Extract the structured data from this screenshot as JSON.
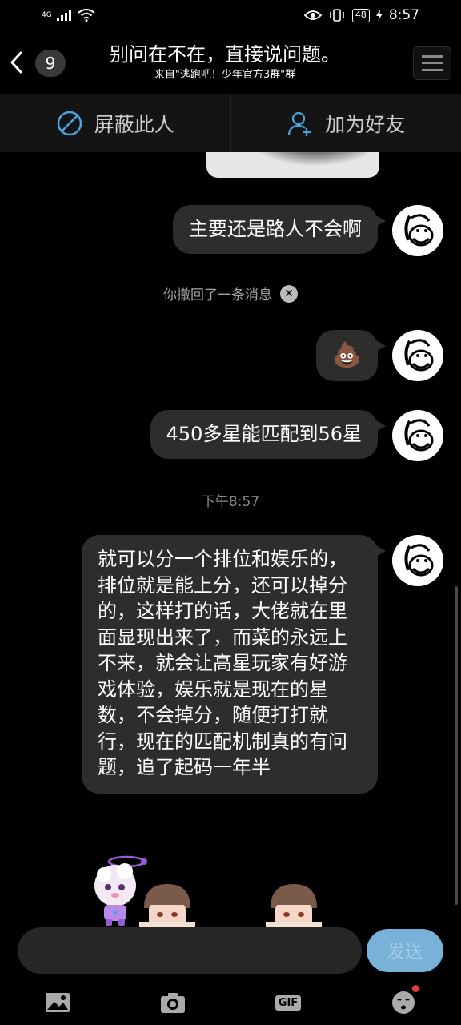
{
  "status_bar": {
    "network": "4G",
    "battery": "48",
    "time": "8:57"
  },
  "header": {
    "unread_count": "9",
    "title": "别问在不在，直接说问题。",
    "subtitle": "来自\"逃跑吧！少年官方3群\"群"
  },
  "actions": {
    "block_label": "屏蔽此人",
    "add_friend_label": "加为好友"
  },
  "messages": [
    {
      "text": "主要还是路人不会啊"
    },
    {
      "text": "💩"
    },
    {
      "text": "450多星能匹配到56星"
    },
    {
      "text": "就可以分一个排位和娱乐的，排位就是能上分，还可以掉分的，这样打的话，大佬就在里面显现出来了，而菜的永远上不来，就会让高星玩家有好游戏体验，娱乐就是现在的星数，不会掉分，随便打打就行，现在的匹配机制真的有问题，追了起码一年半"
    }
  ],
  "system_notice": "你撤回了一条消息",
  "timestamp": "下午8:57",
  "input": {
    "value": "",
    "send_label": "发送"
  },
  "colors": {
    "background": "#000000",
    "bubble": "#2d2d2d",
    "accent_blue": "#4aa3df",
    "send_button": "#78b2d8",
    "notification_dot": "#e83a3a"
  },
  "icons": [
    "back-arrow-icon",
    "hamburger-menu-icon",
    "block-icon",
    "add-person-icon",
    "image-icon",
    "camera-icon",
    "gif-icon",
    "emoji-icon"
  ]
}
